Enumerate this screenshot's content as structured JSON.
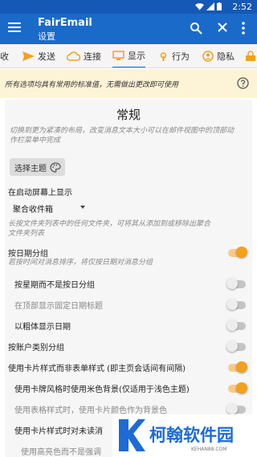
{
  "status_bar": {
    "time": "2:52"
  },
  "app_bar": {
    "title": "FairEmail",
    "subtitle": "设置"
  },
  "tabs": [
    {
      "label": "收",
      "icon": "receive-icon"
    },
    {
      "label": "发送",
      "icon": "send-icon"
    },
    {
      "label": "连接",
      "icon": "cloud-icon"
    },
    {
      "label": "显示",
      "icon": "monitor-icon",
      "active": true
    },
    {
      "label": "行为",
      "icon": "touch-icon"
    },
    {
      "label": "隐私",
      "icon": "privacy-icon"
    }
  ],
  "notice": {
    "text": "所有选项均具有常用的标准值，无需做出更改即可使用"
  },
  "section": {
    "title": "常规",
    "compact_hint_line1": "切换到更为紧凑的布局，改变消息文本大小可以在邮件视图中的顶部动",
    "compact_hint_line2": "作栏菜单中完成",
    "theme_button": "选择主题",
    "start_screen_label": "在启动屏幕上显示",
    "start_screen_value": "聚合收件箱",
    "start_screen_hint_line1": "长按文件夹列表中的任何文件夹，可将其从添加到或移除出聚合",
    "start_screen_hint_line2": "文件夹列表"
  },
  "options": {
    "date_group": "按日期分组",
    "date_group_hint": "若按时间对消息排序，将仅按日期对消息分组",
    "week_group": "按星期而不是按日分组",
    "fixed_date_header": "在顶部显示固定日期标题",
    "bold_date": "以粗体显示日期",
    "category_group": "按账户类别分组",
    "card_style": "使用卡片样式而非表单样式 (即主页会话间有间隔)",
    "beige_bg": "使用卡牌风格时使用米色背景(仅适用于浅色主题)",
    "card_color": "使用表格样式时，使用卡片颜色作为背景色",
    "card_unread": "使用卡片样式时对未读消",
    "highlight": "使用高亮色而不是强调"
  },
  "watermark": {
    "brand": "柯翰软件园",
    "url": "KEHAN88.COM"
  },
  "colors": {
    "primary": "#1a6ac9",
    "toggle_on": "#f2a01e",
    "notice_bg": "#fdf3d7"
  }
}
